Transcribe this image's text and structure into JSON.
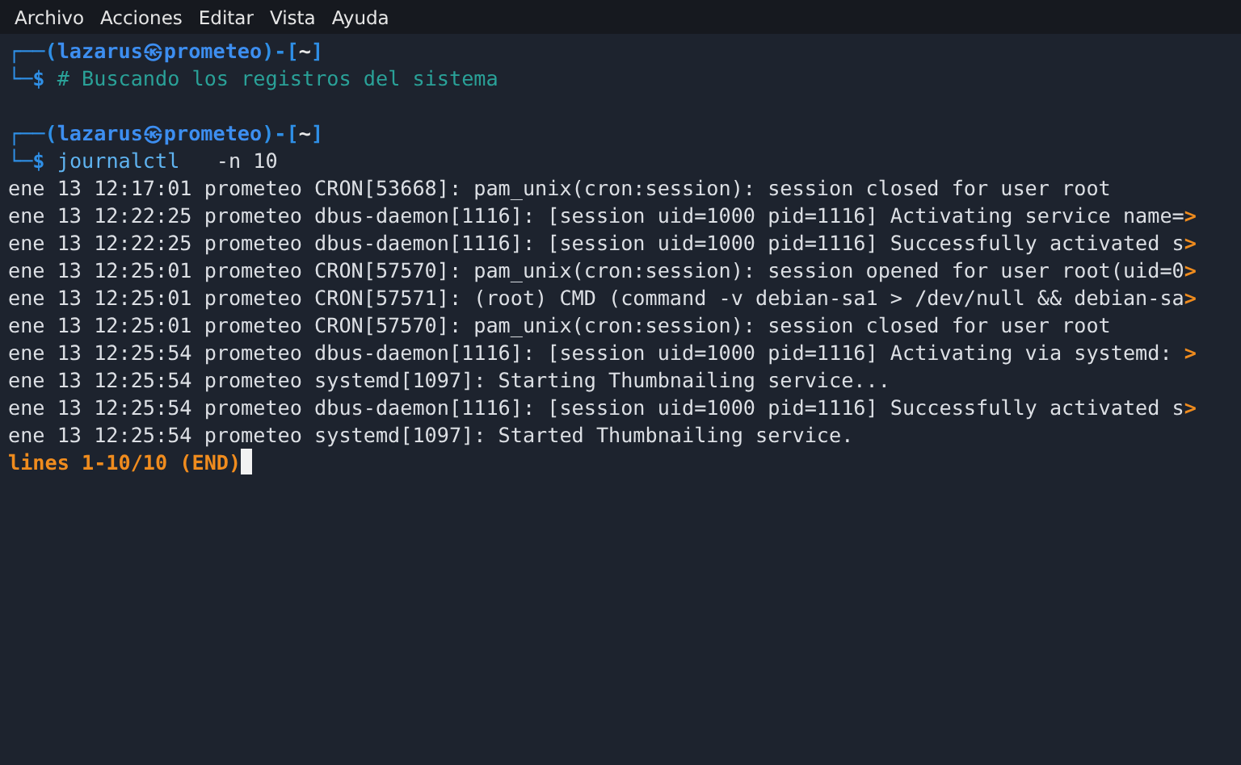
{
  "menu": [
    "Archivo",
    "Acciones",
    "Editar",
    "Vista",
    "Ayuda"
  ],
  "prompts": [
    {
      "open": "┌──(",
      "user": "lazarus",
      "at": "㉿",
      "host": "prometeo",
      "close": ")-[",
      "dir": "~",
      "end": "]",
      "corner": "└─",
      "symbol": "$",
      "kind": "comment",
      "command": "# Buscando los registros del sistema"
    },
    {
      "open": "┌──(",
      "user": "lazarus",
      "at": "㉿",
      "host": "prometeo",
      "close": ")-[",
      "dir": "~",
      "end": "]",
      "corner": "└─",
      "symbol": "$",
      "kind": "command",
      "command": "journalctl",
      "args": "-n 10"
    }
  ],
  "log_lines": [
    {
      "text": "ene 13 12:17:01 prometeo CRON[53668]: pam_unix(cron:session): session closed for user root"
    },
    {
      "text": "ene 13 12:22:25 prometeo dbus-daemon[1116]: [session uid=1000 pid=1116] Activating service name=",
      "overflow": ">"
    },
    {
      "text": "ene 13 12:22:25 prometeo dbus-daemon[1116]: [session uid=1000 pid=1116] Successfully activated s",
      "overflow": ">"
    },
    {
      "text": "ene 13 12:25:01 prometeo CRON[57570]: pam_unix(cron:session): session opened for user root(uid=0",
      "overflow": ">"
    },
    {
      "text": "ene 13 12:25:01 prometeo CRON[57571]: (root) CMD (command -v debian-sa1 > /dev/null && debian-sa",
      "overflow": ">"
    },
    {
      "text": "ene 13 12:25:01 prometeo CRON[57570]: pam_unix(cron:session): session closed for user root"
    },
    {
      "text": "ene 13 12:25:54 prometeo dbus-daemon[1116]: [session uid=1000 pid=1116] Activating via systemd: ",
      "overflow": ">"
    },
    {
      "text": "ene 13 12:25:54 prometeo systemd[1097]: Starting Thumbnailing service..."
    },
    {
      "text": "ene 13 12:25:54 prometeo dbus-daemon[1116]: [session uid=1000 pid=1116] Successfully activated s",
      "overflow": ">"
    },
    {
      "text": "ene 13 12:25:54 prometeo systemd[1097]: Started Thumbnailing service."
    }
  ],
  "pager_status": "lines 1-10/10 (END)"
}
